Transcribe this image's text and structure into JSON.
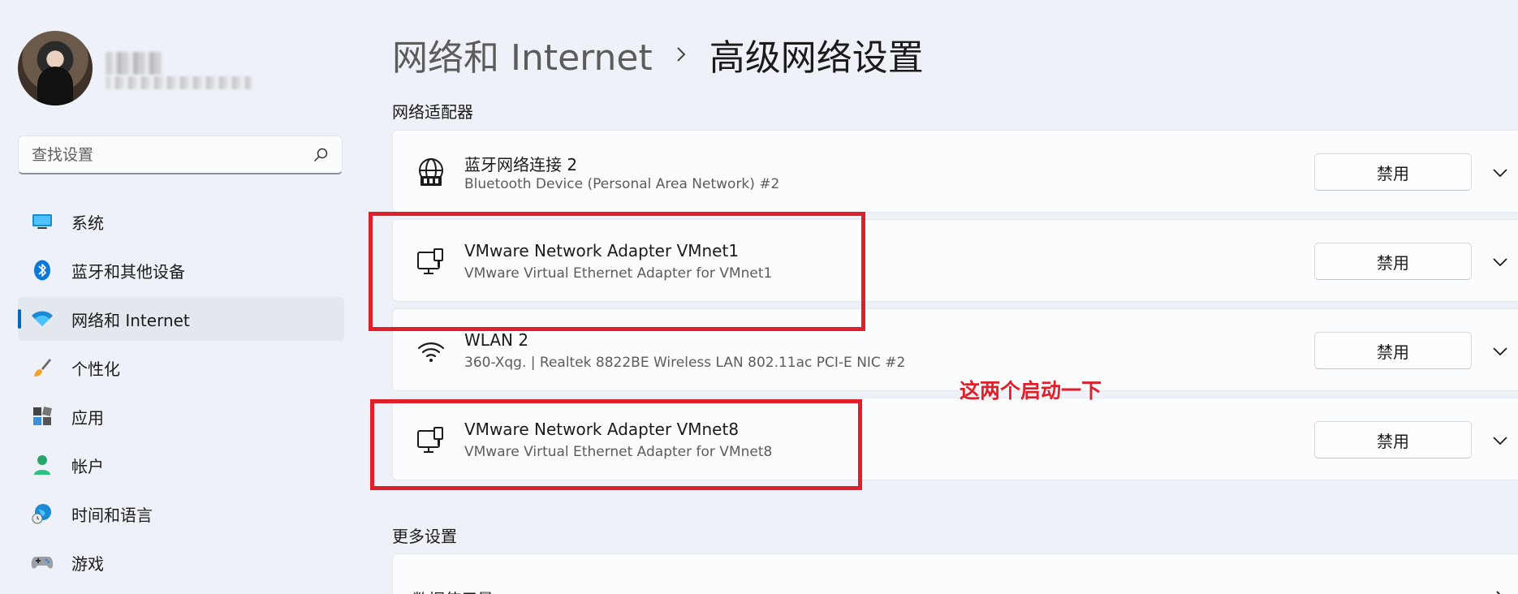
{
  "sidebar": {
    "search": {
      "placeholder": "查找设置",
      "value": ""
    },
    "items": [
      {
        "label": "系统",
        "icon": "monitor-icon"
      },
      {
        "label": "蓝牙和其他设备",
        "icon": "bluetooth-icon"
      },
      {
        "label": "网络和 Internet",
        "icon": "wifi-icon",
        "active": true
      },
      {
        "label": "个性化",
        "icon": "brush-icon"
      },
      {
        "label": "应用",
        "icon": "apps-icon"
      },
      {
        "label": "帐户",
        "icon": "person-icon"
      },
      {
        "label": "时间和语言",
        "icon": "globe-clock-icon"
      },
      {
        "label": "游戏",
        "icon": "gamepad-icon"
      }
    ]
  },
  "header": {
    "parent": "网络和 Internet",
    "current": "高级网络设置"
  },
  "adapters_section": {
    "label": "网络适配器",
    "adapters": [
      {
        "name": "蓝牙网络连接 2",
        "description": "Bluetooth Device (Personal Area Network) #2",
        "icon": "globe-network-icon",
        "button": "禁用"
      },
      {
        "name": "VMware Network Adapter VMnet1",
        "description": "VMware Virtual Ethernet Adapter for VMnet1",
        "icon": "ethernet-icon",
        "button": "禁用"
      },
      {
        "name": "WLAN 2",
        "description": "360-Xqg. | Realtek 8822BE Wireless LAN 802.11ac PCI-E NIC #2",
        "icon": "wifi-icon",
        "button": "禁用"
      },
      {
        "name": "VMware Network Adapter VMnet8",
        "description": "VMware Virtual Ethernet Adapter for VMnet8",
        "icon": "ethernet-icon",
        "button": "禁用"
      }
    ]
  },
  "more_section": {
    "label": "更多设置",
    "first_item": "数据使用量"
  },
  "annotation": {
    "text": "这两个启动一下"
  },
  "colors": {
    "accent": "#0067c0",
    "annotation_red": "#e11f2b",
    "background": "#eef2f8"
  }
}
